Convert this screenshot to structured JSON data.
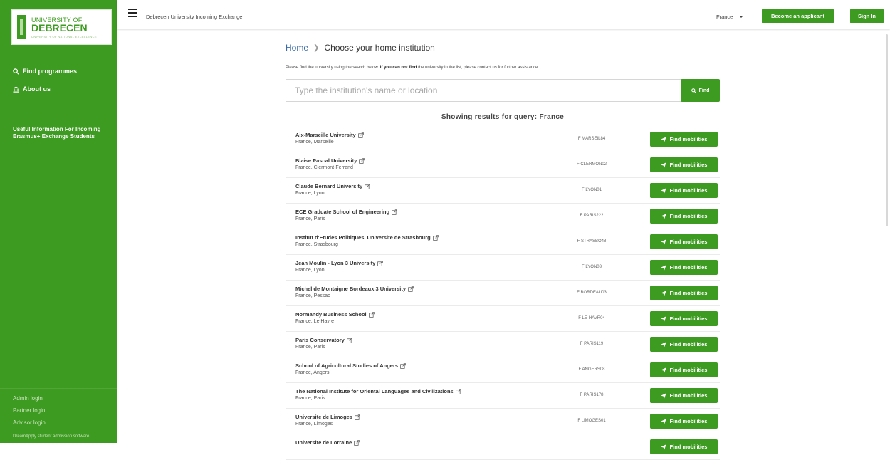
{
  "logo": {
    "line1": "UNIVERSITY OF",
    "line2": "DEBRECEN",
    "tagline": "UNIVERSITY OF NATIONAL EXCELLENCE"
  },
  "sidebar": {
    "find_programmes": "Find programmes",
    "about_us": "About us",
    "useful_info": "Useful Information For Incoming Erasmus+ Exchange Students",
    "admin_login": "Admin login",
    "partner_login": "Partner login",
    "advisor_login": "Advisor login",
    "software": "DreamApply student admission software"
  },
  "topbar": {
    "title": "Debrecen University Incoming Exchange",
    "country": "France",
    "become_applicant": "Become an applicant",
    "sign_in": "Sign In"
  },
  "breadcrumb": {
    "home": "Home",
    "current": "Choose your home institution"
  },
  "instructions": {
    "pre": "Please find the university using the search below. ",
    "bold": "If you can not find",
    "post": " the university in the list, please contact us for further assistance."
  },
  "search": {
    "placeholder": "Type the institution's name or location",
    "button": "Find"
  },
  "query_heading": "Showing results for query: France",
  "mobilities_label": "Find mobilities",
  "results": [
    {
      "name": "Aix-Marseille University",
      "location": "France, Marseille",
      "code": "F MARSEIL84"
    },
    {
      "name": "Blaise Pascal University",
      "location": "France, Clermont-Ferrand",
      "code": "F CLERMON02"
    },
    {
      "name": "Claude Bernard University",
      "location": "France, Lyon",
      "code": "F LYON01"
    },
    {
      "name": "ECE Graduate School of Engineering",
      "location": "France, Paris",
      "code": "F PARIS222"
    },
    {
      "name": "Institut d'Etudes Politiques, Universite de Strasbourg",
      "location": "France, Strasbourg",
      "code": "F STRASBO48"
    },
    {
      "name": "Jean Moulin - Lyon 3 University",
      "location": "France, Lyon",
      "code": "F LYON03"
    },
    {
      "name": "Michel de Montaigne Bordeaux 3 University",
      "location": "France, Pessac",
      "code": "F BORDEAU03"
    },
    {
      "name": "Normandy Business School",
      "location": "France, Le Havre",
      "code": "F LE-HAVR04"
    },
    {
      "name": "Paris Conservatory",
      "location": "France, Paris",
      "code": "F PARIS119"
    },
    {
      "name": "School of Agricultural Studies of Angers",
      "location": "France, Angers",
      "code": "F ANGERS08"
    },
    {
      "name": "The National Institute for Oriental Languages and Civilizations",
      "location": "France, Paris",
      "code": "F PARIS178"
    },
    {
      "name": "Universite de Limoges",
      "location": "France, Limoges",
      "code": "F LIMOGES01"
    },
    {
      "name": "Universite de Lorraine",
      "location": "",
      "code": ""
    }
  ],
  "colors": {
    "brand_green": "#3d9b21",
    "link_blue": "#3b6aa8"
  }
}
